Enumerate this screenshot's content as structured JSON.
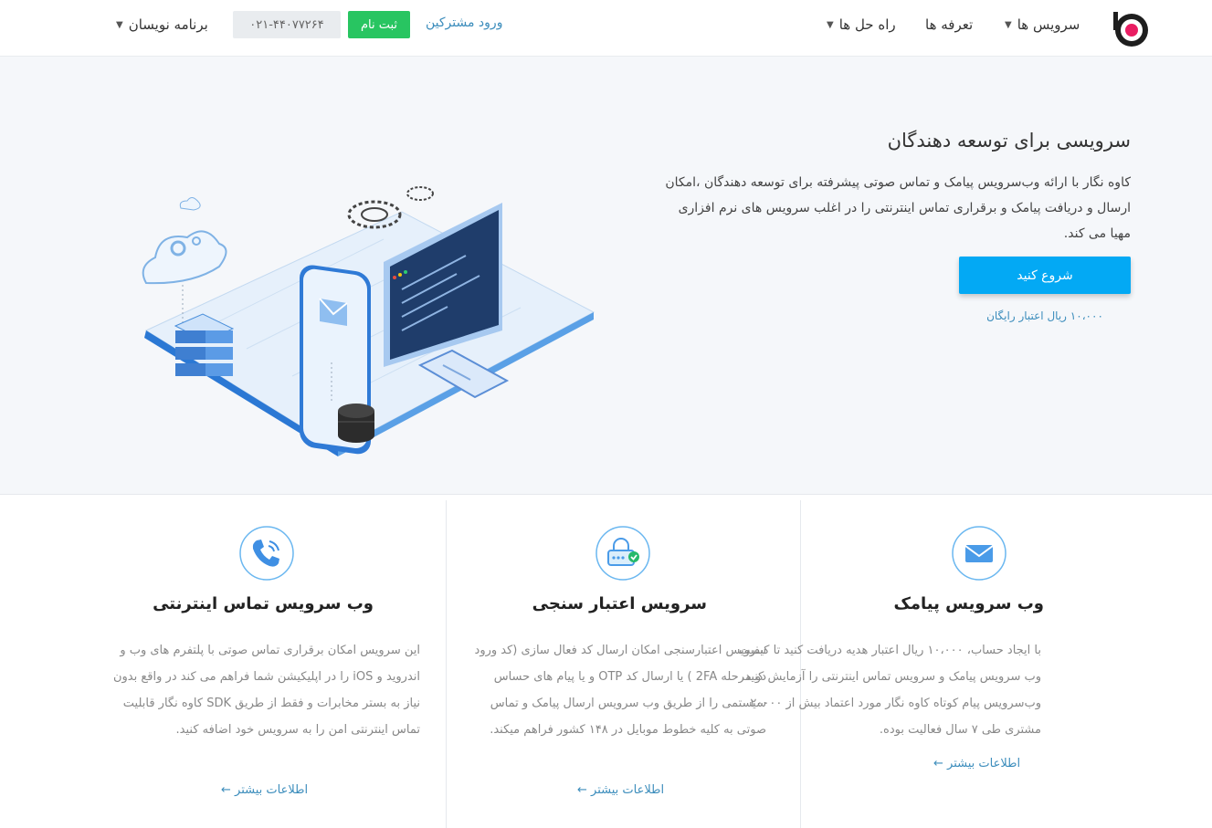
{
  "header": {
    "nav": [
      {
        "label": "سرویس ها",
        "has_dropdown": true
      },
      {
        "label": "تعرفه ها",
        "has_dropdown": false
      },
      {
        "label": "راه حل ها",
        "has_dropdown": true
      },
      {
        "label": "برنامه نویسان",
        "has_dropdown": true
      }
    ],
    "login_label": "ورود مشترکین",
    "signup_label": "ثبت نام",
    "phone": "۰۲۱-۴۴۰۷۷۲۶۴"
  },
  "hero": {
    "title": "سرویسی برای توسعه دهندگان",
    "description": "کاوه نگار با ارائه وب‌سرویس پیامک و تماس صوتی پیشرفته برای توسعه دهندگان ،امکان ارسال و دریافت پیامک و برقراری تماس اینترنتی را در اغلب سرویس های نرم افزاری مهیا می کند.",
    "cta_label": "شروع کنید",
    "credit_note": "۱۰،۰۰۰ ریال اعتبار رایگان"
  },
  "features": [
    {
      "icon": "envelope-icon",
      "title": "وب سرویس پیامک",
      "description": "با ایجاد حساب، ۱۰،۰۰۰ ریال اعتبار هدیه دریافت کنید تا کیفیت وب سرویس پیامک و سرویس تماس اینترنتی را آزمایش کنید، وب‌سرویس پیام کوتاه کاوه نگار مورد اعتماد بیش از ۲۰۰۰۰ مشتری طی ۷ سال فعالیت بوده.",
      "more_label": "اطلاعات بیشتر ←"
    },
    {
      "icon": "lock-check-icon",
      "title": "سرویس اعتبار سنجی",
      "description": "سرویس اعتبارسنجی امکان ارسال کد فعال سازی (کد ورود دو مرحله 2FA ) یا ارسال کد OTP و یا پیام های حساس سیستمی را از طریق وب سرویس ارسال پیامک و تماس صوتی به کلیه خطوط موبایل در ۱۴۸ کشور فراهم میکند.",
      "more_label": "اطلاعات بیشتر ←"
    },
    {
      "icon": "phone-icon",
      "title": "وب سرویس تماس اینترنتی",
      "description": "این سرویس امکان برقراری تماس صوتی با پلتفرم های وب و اندروید و iOS را در اپلیکیشن شما فراهم می کند در واقع بدون نیاز به بستر مخابرات و فقط از طریق SDK کاوه نگار قابلیت تماس اینترنتی امن را به سرویس خود اضافه کنید.",
      "more_label": "اطلاعات بیشتر ←"
    }
  ],
  "colors": {
    "accent": "#03a9f4",
    "signup_green": "#28c561",
    "link": "#3c8dbc",
    "logo_pink": "#e91e63"
  }
}
